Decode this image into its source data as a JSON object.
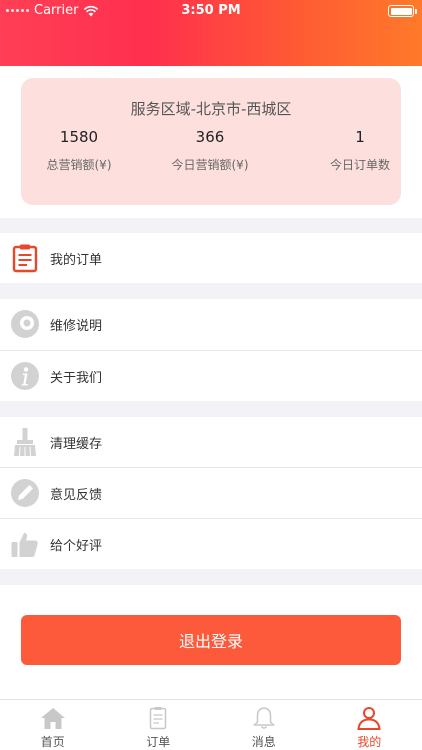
{
  "status_bar": {
    "carrier": "Carrier",
    "time": "3:50 PM"
  },
  "stats": {
    "region": "服务区域-北京市-西城区",
    "items": [
      {
        "value": "1580",
        "label": "总营销额(¥)"
      },
      {
        "value": "366",
        "label": "今日营销额(¥)"
      },
      {
        "value": "1",
        "label": "今日订单数"
      }
    ]
  },
  "menu": {
    "my_orders": "我的订单",
    "repair_info": "维修说明",
    "about_us": "关于我们",
    "clear_cache": "清理缓存",
    "feedback": "意见反馈",
    "rate": "给个好评"
  },
  "logout_label": "退出登录",
  "tabbar": {
    "home": "首页",
    "orders": "订单",
    "messages": "消息",
    "mine": "我的"
  },
  "colors": {
    "accent": "#fd5a3c",
    "card_bg": "#fde0de",
    "icon_gray": "#cfcfcf",
    "active_tab": "#e8472c"
  }
}
